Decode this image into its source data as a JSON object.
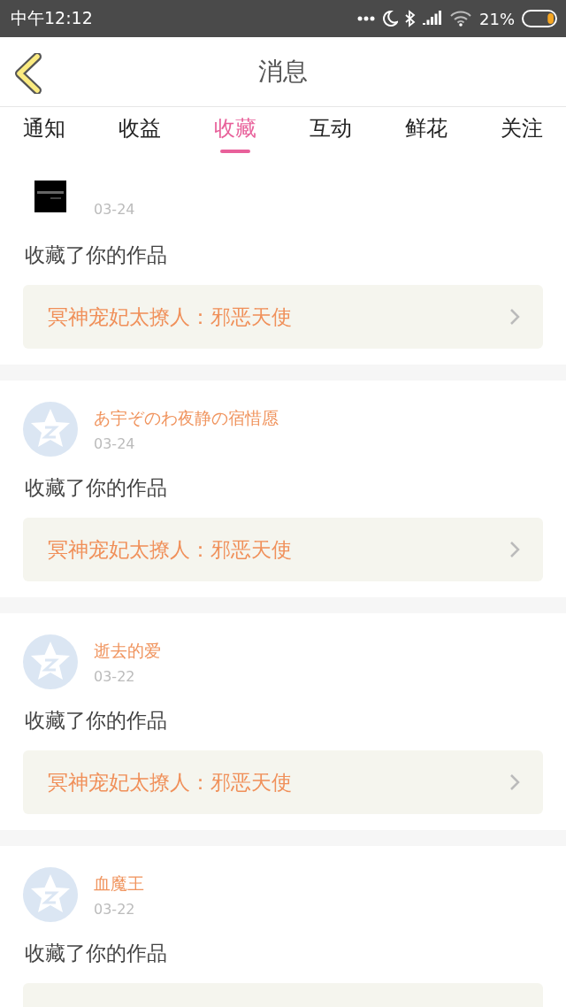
{
  "status_bar": {
    "time": "中午12:12",
    "battery": "21%"
  },
  "header": {
    "title": "消息"
  },
  "tabs": [
    {
      "label": "通知",
      "selected": false
    },
    {
      "label": "收益",
      "selected": false
    },
    {
      "label": "收藏",
      "selected": true
    },
    {
      "label": "互动",
      "selected": false
    },
    {
      "label": "鲜花",
      "selected": false
    },
    {
      "label": "关注",
      "selected": false
    }
  ],
  "items": [
    {
      "date": "03-24",
      "action": "收藏了你的作品",
      "work": "冥神宠妃太撩人：邪恶天使"
    },
    {
      "avatar": {
        "kind": "default"
      },
      "name": "あ宇ぞのわ夜静の宿惜愿",
      "date": "03-24",
      "action": "收藏了你的作品",
      "work": "冥神宠妃太撩人：邪恶天使"
    },
    {
      "avatar": {
        "kind": "default"
      },
      "name": "逝去的爱",
      "date": "03-22",
      "action": "收藏了你的作品",
      "work": "冥神宠妃太撩人：邪恶天使"
    },
    {
      "avatar": {
        "kind": "default"
      },
      "name": "血魔王",
      "date": "03-22",
      "action": "收藏了你的作品"
    }
  ]
}
